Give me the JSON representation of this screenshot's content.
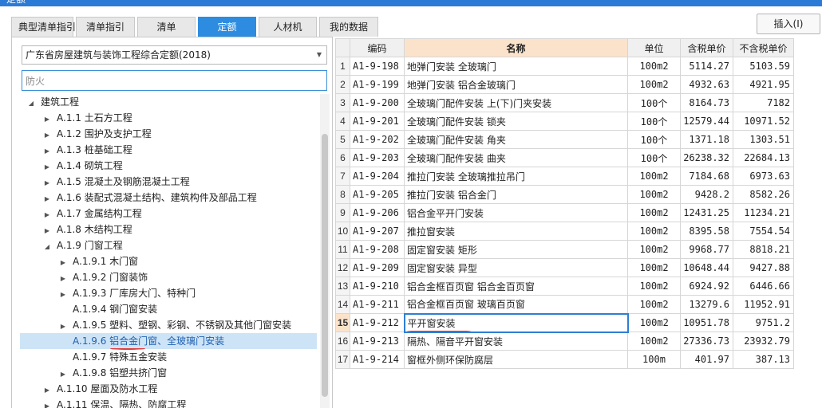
{
  "window": {
    "title": "定额"
  },
  "tabs": [
    {
      "label": "典型清单指引",
      "active": false
    },
    {
      "label": "清单指引",
      "active": false
    },
    {
      "label": "清单",
      "active": false
    },
    {
      "label": "定额",
      "active": true
    },
    {
      "label": "人材机",
      "active": false
    },
    {
      "label": "我的数据",
      "active": false
    }
  ],
  "toolbar": {
    "insert_label": "插入(I)"
  },
  "library_select": {
    "value": "广东省房屋建筑与装饰工程综合定额(2018)"
  },
  "search": {
    "value": "防火"
  },
  "tree": [
    {
      "label": "建筑工程",
      "level": 0,
      "expanded": true
    },
    {
      "label": "A.1.1 土石方工程",
      "level": 1,
      "expanded": false
    },
    {
      "label": "A.1.2 围护及支护工程",
      "level": 1,
      "expanded": false
    },
    {
      "label": "A.1.3 桩基础工程",
      "level": 1,
      "expanded": false
    },
    {
      "label": "A.1.4 砌筑工程",
      "level": 1,
      "expanded": false
    },
    {
      "label": "A.1.5 混凝土及钢筋混凝土工程",
      "level": 1,
      "expanded": false
    },
    {
      "label": "A.1.6 装配式混凝土结构、建筑构件及部品工程",
      "level": 1,
      "expanded": false
    },
    {
      "label": "A.1.7 金属结构工程",
      "level": 1,
      "expanded": false
    },
    {
      "label": "A.1.8 木结构工程",
      "level": 1,
      "expanded": false
    },
    {
      "label": "A.1.9 门窗工程",
      "level": 1,
      "expanded": true
    },
    {
      "label": "A.1.9.1 木门窗",
      "level": 2,
      "expanded": false
    },
    {
      "label": "A.1.9.2 门窗装饰",
      "level": 2,
      "expanded": false
    },
    {
      "label": "A.1.9.3 厂库房大门、特种门",
      "level": 2,
      "expanded": false
    },
    {
      "label": "A.1.9.4 钢门窗安装",
      "level": 2,
      "leaf": true
    },
    {
      "label": "A.1.9.5 塑料、塑钢、彩钢、不锈钢及其他门窗安装",
      "level": 2,
      "expanded": false
    },
    {
      "label": "A.1.9.6 铝合金门窗、全玻璃门安装",
      "level": 2,
      "leaf": true,
      "selected": true
    },
    {
      "label": "A.1.9.7 特殊五金安装",
      "level": 2,
      "leaf": true
    },
    {
      "label": "A.1.9.8 铝塑共挤门窗",
      "level": 2,
      "expanded": false
    },
    {
      "label": "A.1.10 屋面及防水工程",
      "level": 1,
      "expanded": false
    },
    {
      "label": "A.1.11 保温、隔热、防腐工程",
      "level": 1,
      "expanded": false
    }
  ],
  "grid": {
    "headers": {
      "idx": "",
      "code": "编码",
      "name": "名称",
      "unit": "单位",
      "tax_price": "含税单价",
      "notax_price": "不含税单价"
    },
    "current_row": 15,
    "rows": [
      {
        "idx": "1",
        "code": "A1-9-198",
        "name": "地弹门安装 全玻璃门",
        "unit": "100m2",
        "tax_price": "5114.27",
        "notax_price": "5103.59"
      },
      {
        "idx": "2",
        "code": "A1-9-199",
        "name": "地弹门安装 铝合金玻璃门",
        "unit": "100m2",
        "tax_price": "4932.63",
        "notax_price": "4921.95"
      },
      {
        "idx": "3",
        "code": "A1-9-200",
        "name": "全玻璃门配件安装 上(下)门夹安装",
        "unit": "100个",
        "tax_price": "8164.73",
        "notax_price": "7182"
      },
      {
        "idx": "4",
        "code": "A1-9-201",
        "name": "全玻璃门配件安装 锁夹",
        "unit": "100个",
        "tax_price": "12579.44",
        "notax_price": "10971.52"
      },
      {
        "idx": "5",
        "code": "A1-9-202",
        "name": "全玻璃门配件安装 角夹",
        "unit": "100个",
        "tax_price": "1371.18",
        "notax_price": "1303.51"
      },
      {
        "idx": "6",
        "code": "A1-9-203",
        "name": "全玻璃门配件安装 曲夹",
        "unit": "100个",
        "tax_price": "26238.32",
        "notax_price": "22684.13"
      },
      {
        "idx": "7",
        "code": "A1-9-204",
        "name": "推拉门安装 全玻璃推拉吊门",
        "unit": "100m2",
        "tax_price": "7184.68",
        "notax_price": "6973.63"
      },
      {
        "idx": "8",
        "code": "A1-9-205",
        "name": "推拉门安装 铝合金门",
        "unit": "100m2",
        "tax_price": "9428.2",
        "notax_price": "8582.26"
      },
      {
        "idx": "9",
        "code": "A1-9-206",
        "name": "铝合金平开门安装",
        "unit": "100m2",
        "tax_price": "12431.25",
        "notax_price": "11234.21"
      },
      {
        "idx": "10",
        "code": "A1-9-207",
        "name": "推拉窗安装",
        "unit": "100m2",
        "tax_price": "8395.58",
        "notax_price": "7554.54"
      },
      {
        "idx": "11",
        "code": "A1-9-208",
        "name": "固定窗安装 矩形",
        "unit": "100m2",
        "tax_price": "9968.77",
        "notax_price": "8818.21"
      },
      {
        "idx": "12",
        "code": "A1-9-209",
        "name": "固定窗安装 异型",
        "unit": "100m2",
        "tax_price": "10648.44",
        "notax_price": "9427.88"
      },
      {
        "idx": "13",
        "code": "A1-9-210",
        "name": "铝合金框百页窗 铝合金百页窗",
        "unit": "100m2",
        "tax_price": "6924.92",
        "notax_price": "6446.66"
      },
      {
        "idx": "14",
        "code": "A1-9-211",
        "name": "铝合金框百页窗 玻璃百页窗",
        "unit": "100m2",
        "tax_price": "13279.6",
        "notax_price": "11952.91"
      },
      {
        "idx": "15",
        "code": "A1-9-212",
        "name": "平开窗安装",
        "unit": "100m2",
        "tax_price": "10951.78",
        "notax_price": "9751.2"
      },
      {
        "idx": "16",
        "code": "A1-9-213",
        "name": "隔热、隔音平开窗安装",
        "unit": "100m2",
        "tax_price": "27336.73",
        "notax_price": "23932.79"
      },
      {
        "idx": "17",
        "code": "A1-9-214",
        "name": "窗框外侧环保防腐层",
        "unit": "100m",
        "tax_price": "401.97",
        "notax_price": "387.13"
      }
    ]
  }
}
